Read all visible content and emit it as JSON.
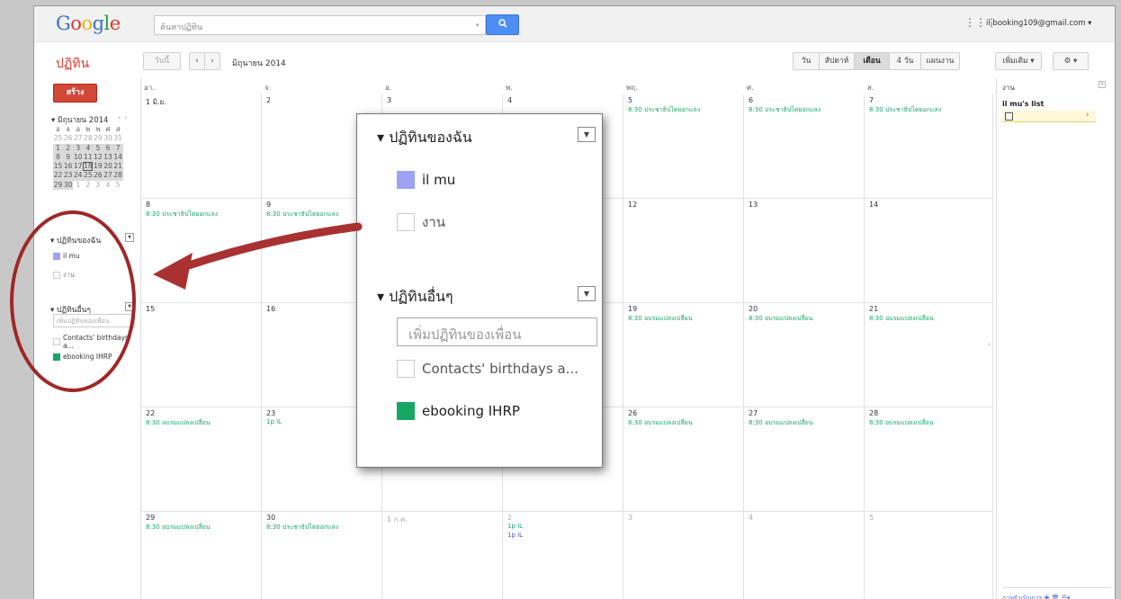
{
  "header": {
    "logo": "Google",
    "search_placeholder": "ค้นหาปฏิทิน",
    "search_icon": "search-icon",
    "apps_icon": "apps-grid-icon",
    "account": "il.booking109@gmail.com ▾"
  },
  "toolbar": {
    "app_title": "ปฏิทิน",
    "today": "วันนี้",
    "prev": "‹",
    "next": "›",
    "date_range": "มิถุนายน 2014",
    "views": {
      "day": "วัน",
      "week": "สัปดาห์",
      "month": "เดือน",
      "four_day": "4 วัน",
      "agenda": "แผนงาน"
    },
    "more": "เพิ่มเติม ▾",
    "settings": "⚙ ▾"
  },
  "sidebar": {
    "create": "สร้าง",
    "mini_month": "▾ มิถุนายน 2014",
    "mini_nav": "‹›",
    "weekdays": [
      "อา",
      "จ",
      "อ",
      "พ",
      "พฤ",
      "ศ",
      "ส"
    ],
    "weeks": [
      [
        "25",
        "26",
        "27",
        "28",
        "29",
        "30",
        "31"
      ],
      [
        "1",
        "2",
        "3",
        "4",
        "5",
        "6",
        "7"
      ],
      [
        "8",
        "9",
        "10",
        "11",
        "12",
        "13",
        "14"
      ],
      [
        "15",
        "16",
        "17",
        "18",
        "19",
        "20",
        "21"
      ],
      [
        "22",
        "23",
        "24",
        "25",
        "26",
        "27",
        "28"
      ],
      [
        "29",
        "30",
        "1",
        "2",
        "3",
        "4",
        "5"
      ]
    ],
    "my_calendars": "▾ ปฏิทินของฉัน",
    "my_items": [
      {
        "label": "il mu",
        "color": "#9ea2f5"
      },
      {
        "label": "งาน",
        "color": "#ffffff"
      }
    ],
    "other_calendars": "▾ ปฏิทินอื่นๆ",
    "add_friend_placeholder": "เพิ่มปฏิทินของเพื่อน",
    "other_items": [
      {
        "label": "Contacts' birthdays a...",
        "color": "#ffffff"
      },
      {
        "label": "ebooking IHRP",
        "color": "#16a765"
      }
    ]
  },
  "grid": {
    "day_headers": [
      "อา.",
      "จ.",
      "อ.",
      "พ.",
      "พฤ.",
      "ศ.",
      "ส."
    ],
    "weeks": [
      [
        {
          "d": "1 มิ.ย.",
          "ev": []
        },
        {
          "d": "2",
          "ev": []
        },
        {
          "d": "3",
          "ev": []
        },
        {
          "d": "4",
          "ev": []
        },
        {
          "d": "5",
          "ev": [
            {
              "t": "8:30 ประชาธิปไตยอกแลง",
              "c": "g"
            }
          ]
        },
        {
          "d": "6",
          "ev": [
            {
              "t": "8:30 ประชาธิปไตยอกแลง",
              "c": "g"
            }
          ]
        },
        {
          "d": "7",
          "ev": [
            {
              "t": "8:30 ประชาธิปไตยอกแลง",
              "c": "g"
            }
          ]
        }
      ],
      [
        {
          "d": "8",
          "ev": [
            {
              "t": "8:30 ประชาธิปไตยอกแลง",
              "c": "g"
            }
          ]
        },
        {
          "d": "9",
          "ev": [
            {
              "t": "8:30 ประชาธิปไตยอกแลง",
              "c": "g"
            }
          ]
        },
        {
          "d": "",
          "ev": []
        },
        {
          "d": "",
          "ev": []
        },
        {
          "d": "12",
          "ev": []
        },
        {
          "d": "13",
          "ev": []
        },
        {
          "d": "14",
          "ev": []
        }
      ],
      [
        {
          "d": "15",
          "ev": []
        },
        {
          "d": "16",
          "ev": []
        },
        {
          "d": "",
          "ev": []
        },
        {
          "d": "",
          "ev": []
        },
        {
          "d": "19",
          "ev": [
            {
              "t": "8:30 อบรมแปลงเปลี่ยน",
              "c": "g"
            }
          ]
        },
        {
          "d": "20",
          "ev": [
            {
              "t": "8:30 อบรมแปลงเปลี่ยน",
              "c": "g"
            }
          ]
        },
        {
          "d": "21",
          "ev": [
            {
              "t": "8:30 อบรมแปลงเปลี่ยน",
              "c": "g"
            }
          ]
        }
      ],
      [
        {
          "d": "22",
          "ev": [
            {
              "t": "8:30 อบรมแปลงเปลี่ยน",
              "c": "g"
            }
          ]
        },
        {
          "d": "23",
          "ev": [
            {
              "t": "1p IL",
              "c": "g"
            }
          ]
        },
        {
          "d": "",
          "ev": []
        },
        {
          "d": "",
          "ev": []
        },
        {
          "d": "26",
          "ev": [
            {
              "t": "8:30 อบรมแปลงเปลี่ยน",
              "c": "g"
            }
          ]
        },
        {
          "d": "27",
          "ev": [
            {
              "t": "8:30 อบรมแปลงเปลี่ยน",
              "c": "g"
            }
          ]
        },
        {
          "d": "28",
          "ev": [
            {
              "t": "8:30 อบรมแปลงเปลี่ยน",
              "c": "g"
            }
          ]
        }
      ],
      [
        {
          "d": "29",
          "ev": [
            {
              "t": "8:30 อบรมแปลงเปลี่ยน",
              "c": "g"
            }
          ]
        },
        {
          "d": "30",
          "ev": [
            {
              "t": "8:30 ประชาธิปไตยอกแลง",
              "c": "g"
            }
          ]
        },
        {
          "d": "1 ก.ค.",
          "dim": true,
          "ev": []
        },
        {
          "d": "2",
          "dim": true,
          "ev": [
            {
              "t": "1p IL",
              "c": "g"
            },
            {
              "t": "1p IL",
              "c": "b"
            }
          ]
        },
        {
          "d": "3",
          "dim": true,
          "ev": []
        },
        {
          "d": "4",
          "dim": true,
          "ev": []
        },
        {
          "d": "5",
          "dim": true,
          "ev": []
        }
      ]
    ]
  },
  "tasks": {
    "title": "งาน",
    "list_name": "il mu's list",
    "footer": "การดำเนินการ ✚ 🗑 ☰▾"
  },
  "popup": {
    "my_calendars": "ปฏิทินของฉัน",
    "item1": "il mu",
    "item2": "งาน",
    "other_calendars": "ปฏิทินอื่นๆ",
    "add_placeholder": "เพิ่มปฏิทินของเพื่อน",
    "item3": "Contacts' birthdays a...",
    "item4": "ebooking IHRP"
  },
  "colors": {
    "green_event": "#16a765",
    "blue_event": "#4a54d0",
    "accent_red": "#d9382c",
    "annotation": "#a02828"
  }
}
